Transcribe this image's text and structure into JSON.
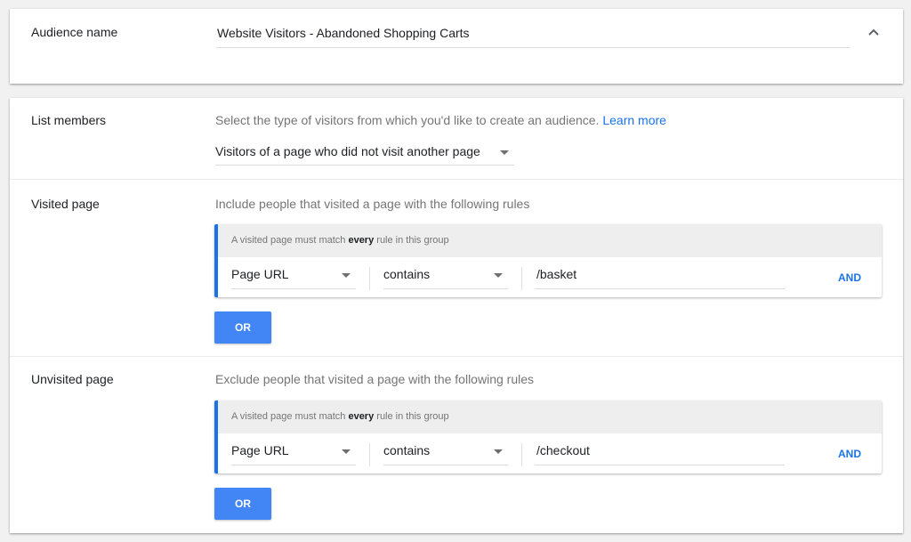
{
  "audience": {
    "label": "Audience name",
    "value": "Website Visitors - Abandoned Shopping Carts"
  },
  "list_members": {
    "label": "List members",
    "description": "Select the type of visitors from which you'd like to create an audience.",
    "learn_more": "Learn more",
    "selected": "Visitors of a page who did not visit another page"
  },
  "visited": {
    "label": "Visited page",
    "description": "Include people that visited a page with the following rules",
    "group_header_pre": "A visited page must match ",
    "group_header_bold": "every",
    "group_header_post": " rule in this group",
    "rule": {
      "field": "Page URL",
      "operator": "contains",
      "value": "/basket"
    },
    "and_label": "AND",
    "or_label": "OR"
  },
  "unvisited": {
    "label": "Unvisited page",
    "description": "Exclude people that visited a page with the following rules",
    "group_header_pre": "A visited page must match ",
    "group_header_bold": "every",
    "group_header_post": " rule in this group",
    "rule": {
      "field": "Page URL",
      "operator": "contains",
      "value": "/checkout"
    },
    "and_label": "AND",
    "or_label": "OR"
  },
  "colors": {
    "accent": "#1a73e8",
    "button": "#4285f4",
    "background": "#f1f1f1"
  },
  "icons": {
    "collapse": "chevron-up-icon",
    "dropdown": "caret-down-icon"
  }
}
